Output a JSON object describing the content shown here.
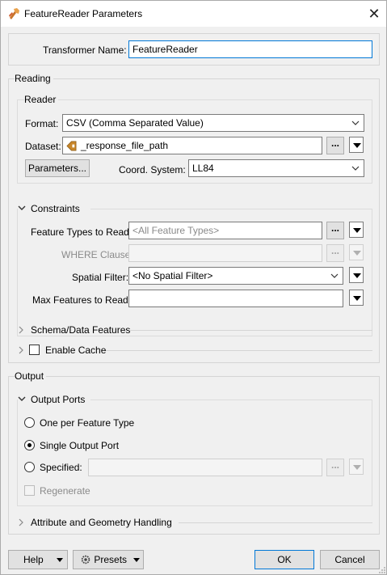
{
  "window": {
    "title": "FeatureReader Parameters"
  },
  "transformer": {
    "label": "Transformer Name:",
    "value": "FeatureReader"
  },
  "reading": {
    "group_label": "Reading",
    "reader": {
      "group_label": "Reader",
      "format_label": "Format:",
      "format_value": "CSV (Comma Separated Value)",
      "dataset_label": "Dataset:",
      "dataset_value": "_response_file_path",
      "parameters_button": "Parameters...",
      "coord_label": "Coord. System:",
      "coord_value": "LL84"
    },
    "constraints": {
      "label": "Constraints",
      "feature_types_label": "Feature Types to Read:",
      "feature_types_placeholder": "<All Feature Types>",
      "where_label": "WHERE Clause:",
      "spatial_label": "Spatial Filter:",
      "spatial_value": "<No Spatial Filter>",
      "max_label": "Max Features to Read:",
      "max_value": ""
    },
    "schema_label": "Schema/Data Features",
    "cache_label": "Enable Cache"
  },
  "output": {
    "group_label": "Output",
    "ports_label": "Output Ports",
    "option_one": "One per Feature Type",
    "option_single": "Single Output Port",
    "option_specified": "Specified:",
    "specified_value": "",
    "regenerate_label": "Regenerate",
    "attr_label": "Attribute and Geometry Handling"
  },
  "buttons": {
    "ellipsis": "...",
    "help": "Help",
    "presets": "Presets",
    "ok": "OK",
    "cancel": "Cancel"
  }
}
